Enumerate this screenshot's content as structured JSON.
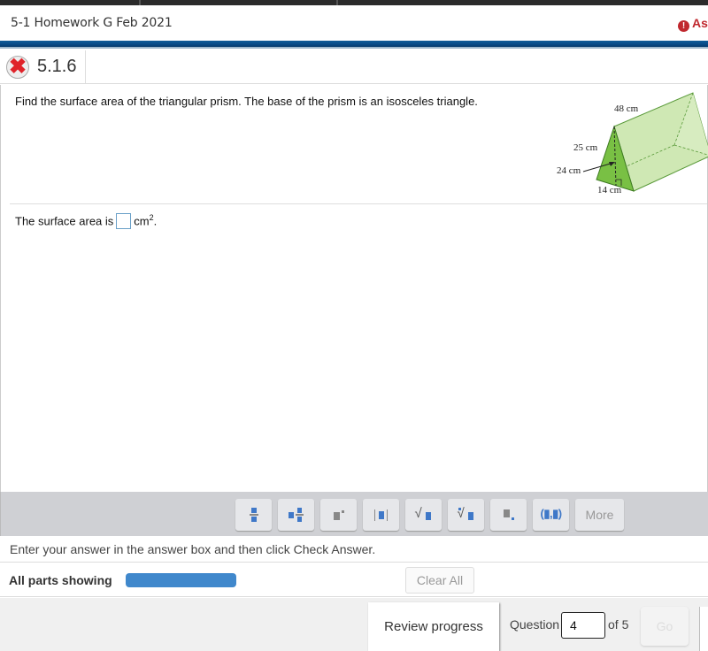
{
  "header": {
    "title": "5-1 Homework G Feb 2021",
    "assignment_link": "Ass",
    "alert_color": "#c0282e",
    "band_color": "#074a86"
  },
  "question": {
    "status_icon": "x-incorrect-icon",
    "number": "5.1.6",
    "prompt": "Find the surface area of the triangular prism. The base of the prism is an isosceles triangle.",
    "answer_prefix": "The surface area is",
    "answer_value": "",
    "answer_unit": "cm",
    "answer_exponent": "2",
    "answer_suffix": "."
  },
  "figure": {
    "length_label": "48 cm",
    "slant_label": "25 cm",
    "height_label": "24 cm",
    "base_label": "14 cm"
  },
  "toolbar": {
    "buttons": [
      {
        "name": "fraction-icon"
      },
      {
        "name": "mixed-number-icon"
      },
      {
        "name": "exponent-icon"
      },
      {
        "name": "absolute-value-icon"
      },
      {
        "name": "square-root-icon"
      },
      {
        "name": "nth-root-icon"
      },
      {
        "name": "subscript-icon"
      },
      {
        "name": "ordered-pair-icon"
      }
    ],
    "more_label": "More"
  },
  "instruction": "Enter your answer in the answer box and then click Check Answer.",
  "parts": {
    "label": "All parts showing",
    "progress": 1.0,
    "clear_label": "Clear All"
  },
  "footer": {
    "review_label": "Review progress",
    "question_label": "Question",
    "question_value": "4",
    "of_label": "of 5",
    "go_label": "Go"
  }
}
